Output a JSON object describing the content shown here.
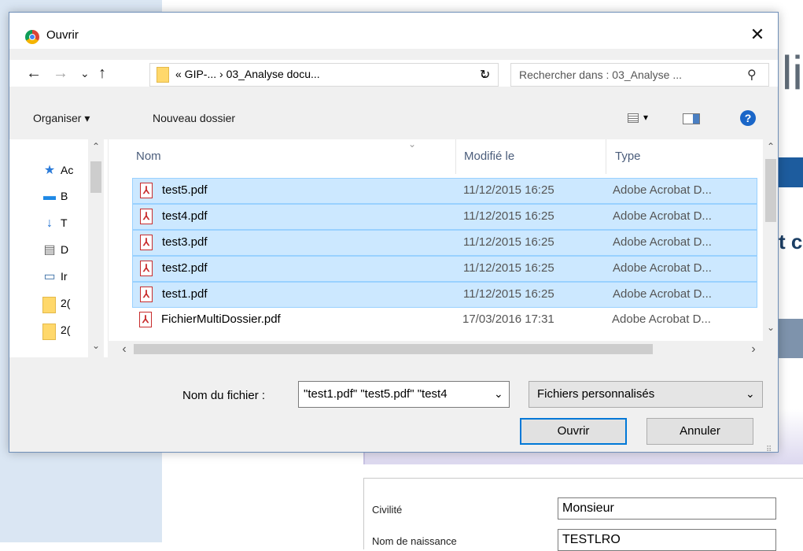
{
  "background": {
    "heading_partial": "li",
    "text_partial": "t c",
    "form": {
      "label_civilite": "Civilité",
      "value_civilite": "Monsieur",
      "label_nom": "Nom de naissance",
      "value_nom": "TESTLRO"
    }
  },
  "dialog": {
    "title": "Ouvrir",
    "close_glyph": "✕",
    "nav": {
      "back": "←",
      "forward": "→",
      "recent": "⌄",
      "up": "↑",
      "address": "«  GIP-...  ›  03_Analyse docu...",
      "address_dropdown": "⌄",
      "refresh": "↻",
      "search_placeholder": "Rechercher dans : 03_Analyse ...",
      "search_glyph": "⚲"
    },
    "toolbar": {
      "organize": "Organiser ▾",
      "new_folder": "Nouveau dossier",
      "view_dropdown": "▾",
      "help": "?"
    },
    "navpane": {
      "items": [
        {
          "icon": "★",
          "label": "Ac"
        },
        {
          "icon": "▬",
          "label": "B"
        },
        {
          "icon": "↓",
          "label": "T"
        },
        {
          "icon": "▤",
          "label": "D"
        },
        {
          "icon": "▭",
          "label": "Ir"
        },
        {
          "icon": "",
          "label": "2("
        },
        {
          "icon": "",
          "label": "2("
        }
      ],
      "scroll_up": "⌃",
      "scroll_down": "⌄"
    },
    "columns": {
      "name": "Nom",
      "modified": "Modifié le",
      "type": "Type",
      "sort": "⌄"
    },
    "files": [
      {
        "name": "test5.pdf",
        "date": "11/12/2015 16:25",
        "type": "Adobe Acrobat D...",
        "selected": true
      },
      {
        "name": "test4.pdf",
        "date": "11/12/2015 16:25",
        "type": "Adobe Acrobat D...",
        "selected": true
      },
      {
        "name": "test3.pdf",
        "date": "11/12/2015 16:25",
        "type": "Adobe Acrobat D...",
        "selected": true
      },
      {
        "name": "test2.pdf",
        "date": "11/12/2015 16:25",
        "type": "Adobe Acrobat D...",
        "selected": true
      },
      {
        "name": "test1.pdf",
        "date": "11/12/2015 16:25",
        "type": "Adobe Acrobat D...",
        "selected": true
      },
      {
        "name": "FichierMultiDossier.pdf",
        "date": "17/03/2016 17:31",
        "type": "Adobe Acrobat D...",
        "selected": false
      }
    ],
    "scroll": {
      "up": "⌃",
      "down": "⌄",
      "left": "‹",
      "right": "›"
    },
    "filename_label": "Nom du fichier :",
    "filename_value": "\"test1.pdf\" \"test5.pdf\" \"test4",
    "filename_dropdown": "⌄",
    "filter_value": "Fichiers personnalisés",
    "filter_dropdown": "⌄",
    "open_button": "Ouvrir",
    "cancel_button": "Annuler",
    "grip": "⠿"
  }
}
